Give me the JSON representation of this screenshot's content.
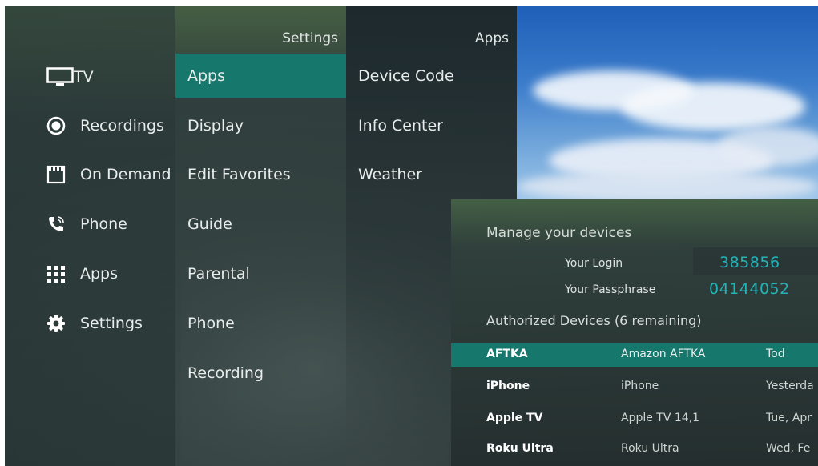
{
  "main_menu": {
    "items": [
      {
        "label": "TV",
        "icon": "tv-icon"
      },
      {
        "label": "Recordings",
        "icon": "record-icon"
      },
      {
        "label": "On Demand",
        "icon": "film-icon"
      },
      {
        "label": "Phone",
        "icon": "phone-icon"
      },
      {
        "label": "Apps",
        "icon": "apps-grid-icon"
      },
      {
        "label": "Settings",
        "icon": "gear-icon"
      }
    ]
  },
  "settings_menu": {
    "title": "Settings",
    "items": [
      "Apps",
      "Display",
      "Edit Favorites",
      "Guide",
      "Parental",
      "Phone",
      "Recording"
    ],
    "selected": "Apps"
  },
  "apps_menu": {
    "title": "Apps",
    "items": [
      "Device Code",
      "Info Center",
      "Weather"
    ]
  },
  "devices_panel": {
    "title": "Manage your devices",
    "login_label": "Your Login",
    "login_value": "385856",
    "passphrase_label": "Your Passphrase",
    "passphrase_value": "04144052",
    "authorized_title": "Authorized Devices (6 remaining)",
    "devices": [
      {
        "name": "AFTKA",
        "model": "Amazon AFTKA",
        "last_used": "Tod"
      },
      {
        "name": "iPhone",
        "model": "iPhone",
        "last_used": "Yesterda"
      },
      {
        "name": "Apple TV",
        "model": "Apple TV 14,1",
        "last_used": "Tue, Apr"
      },
      {
        "name": "Roku Ultra",
        "model": "Roku Ultra",
        "last_used": "Wed, Fe"
      }
    ]
  },
  "colors": {
    "accent": "#16776c",
    "code_text": "#22b3b8"
  }
}
